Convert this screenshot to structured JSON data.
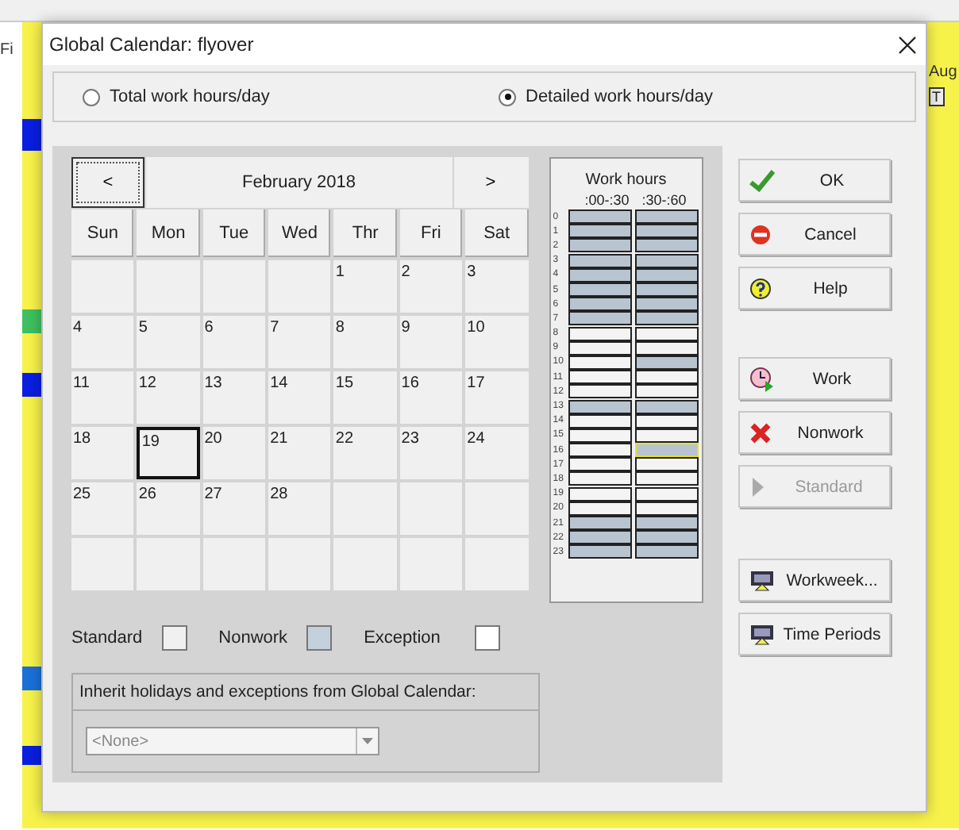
{
  "background_app": {
    "menu_fragment": "Fi",
    "month_fragment": "Aug",
    "day_headers": [
      "T"
    ]
  },
  "window": {
    "title": "Global Calendar: flyover"
  },
  "mode_options": [
    {
      "label": "Total work hours/day",
      "selected": false
    },
    {
      "label": "Detailed work hours/day",
      "selected": true
    }
  ],
  "calendar": {
    "prev": "<",
    "month": "February 2018",
    "next": ">",
    "weekdays": [
      "Sun",
      "Mon",
      "Tue",
      "Wed",
      "Thr",
      "Fri",
      "Sat"
    ],
    "weeks": [
      [
        {
          "selected": false
        },
        {
          "selected": false
        },
        {
          "selected": false
        },
        {
          "selected": false
        },
        {
          "day": "1",
          "selected": false
        },
        {
          "day": "2",
          "selected": false
        },
        {
          "day": "3",
          "selected": false
        }
      ],
      [
        {
          "day": "4",
          "selected": false
        },
        {
          "day": "5",
          "selected": false
        },
        {
          "day": "6",
          "selected": false
        },
        {
          "day": "7",
          "selected": false
        },
        {
          "day": "8",
          "selected": false
        },
        {
          "day": "9",
          "selected": false
        },
        {
          "day": "10",
          "selected": false
        }
      ],
      [
        {
          "day": "11",
          "selected": false
        },
        {
          "day": "12",
          "selected": false
        },
        {
          "day": "13",
          "selected": false
        },
        {
          "day": "14",
          "selected": false
        },
        {
          "day": "15",
          "selected": false
        },
        {
          "day": "16",
          "selected": false
        },
        {
          "day": "17",
          "selected": false
        }
      ],
      [
        {
          "day": "18",
          "selected": false
        },
        {
          "day": "19",
          "selected": true
        },
        {
          "day": "20",
          "selected": false
        },
        {
          "day": "21",
          "selected": false
        },
        {
          "day": "22",
          "selected": false
        },
        {
          "day": "23",
          "selected": false
        },
        {
          "day": "24",
          "selected": false
        }
      ],
      [
        {
          "day": "25",
          "selected": false
        },
        {
          "day": "26",
          "selected": false
        },
        {
          "day": "27",
          "selected": false
        },
        {
          "day": "28",
          "selected": false
        },
        {
          "selected": false
        },
        {
          "selected": false
        },
        {
          "selected": false
        }
      ],
      [
        {
          "selected": false
        },
        {
          "selected": false
        },
        {
          "selected": false
        },
        {
          "selected": false
        },
        {
          "selected": false
        },
        {
          "selected": false
        },
        {
          "selected": false
        }
      ]
    ]
  },
  "work_hours": {
    "title": "Work hours",
    "columns": [
      ":00-:30",
      ":30-:60"
    ],
    "rows": [
      {
        "hour": "0",
        "slots": [
          {
            "work": false,
            "selected": false
          },
          {
            "work": false,
            "selected": false
          }
        ]
      },
      {
        "hour": "1",
        "slots": [
          {
            "work": false,
            "selected": false
          },
          {
            "work": false,
            "selected": false
          }
        ]
      },
      {
        "hour": "2",
        "slots": [
          {
            "work": false,
            "selected": false
          },
          {
            "work": false,
            "selected": false
          }
        ]
      },
      {
        "hour": "3",
        "slots": [
          {
            "work": false,
            "selected": false
          },
          {
            "work": false,
            "selected": false
          }
        ]
      },
      {
        "hour": "4",
        "slots": [
          {
            "work": false,
            "selected": false
          },
          {
            "work": false,
            "selected": false
          }
        ]
      },
      {
        "hour": "5",
        "slots": [
          {
            "work": false,
            "selected": false
          },
          {
            "work": false,
            "selected": false
          }
        ]
      },
      {
        "hour": "6",
        "slots": [
          {
            "work": false,
            "selected": false
          },
          {
            "work": false,
            "selected": false
          }
        ]
      },
      {
        "hour": "7",
        "slots": [
          {
            "work": false,
            "selected": false
          },
          {
            "work": false,
            "selected": false
          }
        ]
      },
      {
        "hour": "8",
        "slots": [
          {
            "work": true,
            "selected": false
          },
          {
            "work": true,
            "selected": false
          }
        ]
      },
      {
        "hour": "9",
        "slots": [
          {
            "work": true,
            "selected": false
          },
          {
            "work": true,
            "selected": false
          }
        ]
      },
      {
        "hour": "10",
        "slots": [
          {
            "work": true,
            "selected": false
          },
          {
            "work": false,
            "selected": false
          }
        ]
      },
      {
        "hour": "11",
        "slots": [
          {
            "work": true,
            "selected": false
          },
          {
            "work": true,
            "selected": false
          }
        ]
      },
      {
        "hour": "12",
        "slots": [
          {
            "work": true,
            "selected": false
          },
          {
            "work": true,
            "selected": false
          }
        ]
      },
      {
        "hour": "13",
        "slots": [
          {
            "work": false,
            "selected": false
          },
          {
            "work": false,
            "selected": false
          }
        ]
      },
      {
        "hour": "14",
        "slots": [
          {
            "work": true,
            "selected": false
          },
          {
            "work": true,
            "selected": false
          }
        ]
      },
      {
        "hour": "15",
        "slots": [
          {
            "work": true,
            "selected": false
          },
          {
            "work": true,
            "selected": false
          }
        ]
      },
      {
        "hour": "16",
        "slots": [
          {
            "work": true,
            "selected": false
          },
          {
            "work": false,
            "selected": true
          }
        ]
      },
      {
        "hour": "17",
        "slots": [
          {
            "work": true,
            "selected": false
          },
          {
            "work": true,
            "selected": false
          }
        ]
      },
      {
        "hour": "18",
        "slots": [
          {
            "work": true,
            "selected": false
          },
          {
            "work": true,
            "selected": false
          }
        ]
      },
      {
        "hour": "19",
        "slots": [
          {
            "work": true,
            "selected": false
          },
          {
            "work": true,
            "selected": false
          }
        ]
      },
      {
        "hour": "20",
        "slots": [
          {
            "work": true,
            "selected": false
          },
          {
            "work": true,
            "selected": false
          }
        ]
      },
      {
        "hour": "21",
        "slots": [
          {
            "work": false,
            "selected": false
          },
          {
            "work": false,
            "selected": false
          }
        ]
      },
      {
        "hour": "22",
        "slots": [
          {
            "work": false,
            "selected": false
          },
          {
            "work": false,
            "selected": false
          }
        ]
      },
      {
        "hour": "23",
        "slots": [
          {
            "work": false,
            "selected": false
          },
          {
            "work": false,
            "selected": false
          }
        ]
      }
    ]
  },
  "legend": [
    {
      "label": "Standard",
      "kind": "standard"
    },
    {
      "label": "Nonwork",
      "kind": "nonwork"
    },
    {
      "label": "Exception",
      "kind": "exception"
    }
  ],
  "inherit": {
    "label": "Inherit holidays and exceptions from Global Calendar:",
    "value": "<None>",
    "disabled": true
  },
  "dialog_buttons": [
    {
      "label": "OK",
      "kind": "ok",
      "disabled": false
    },
    {
      "label": "Cancel",
      "kind": "cancel",
      "disabled": false
    },
    {
      "label": "Help",
      "kind": "help",
      "disabled": false
    }
  ],
  "day_buttons": [
    {
      "label": "Work",
      "kind": "work",
      "disabled": false
    },
    {
      "label": "Nonwork",
      "kind": "nonwork",
      "disabled": false
    },
    {
      "label": "Standard",
      "kind": "standard",
      "disabled": true
    }
  ],
  "settings_buttons": [
    {
      "label": "Workweek...",
      "disabled": false
    },
    {
      "label": "Time Periods",
      "disabled": false
    }
  ]
}
